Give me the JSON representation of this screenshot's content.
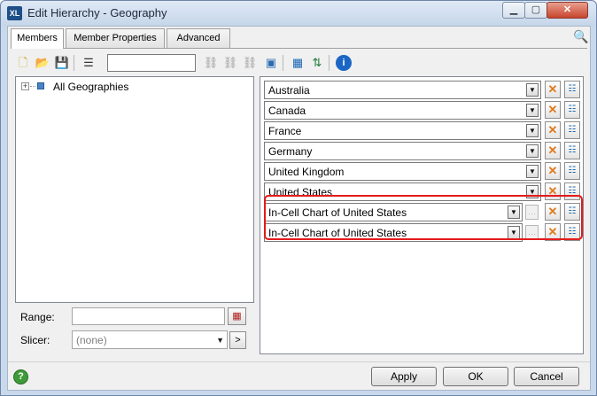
{
  "window": {
    "app_icon": "XL",
    "title": "Edit Hierarchy - Geography",
    "minimize_glyph": "▁",
    "maximize_glyph": "▢",
    "close_glyph": "✕"
  },
  "tabs": [
    {
      "label": "Members",
      "active": true
    },
    {
      "label": "Member Properties",
      "active": false
    },
    {
      "label": "Advanced",
      "active": false
    }
  ],
  "toolbar": {
    "icons": [
      "new-icon",
      "open-icon",
      "save-icon",
      "tree-icon",
      "search-field",
      "link-icon",
      "link-add-icon",
      "link-remove-icon",
      "browse-icon",
      "calendar-icon",
      "sort-icon",
      "info-icon"
    ],
    "search_value": ""
  },
  "tree": {
    "root_label": "All Geographies",
    "expander": "+"
  },
  "range": {
    "label": "Range:",
    "value": ""
  },
  "slicer": {
    "label": "Slicer:",
    "value": "(none)",
    "go_glyph": ">"
  },
  "members": [
    {
      "label": "Australia"
    },
    {
      "label": "Canada"
    },
    {
      "label": "France"
    },
    {
      "label": "Germany"
    },
    {
      "label": "United Kingdom"
    },
    {
      "label": "United States"
    },
    {
      "label": "In-Cell Chart of United States"
    },
    {
      "label": "In-Cell Chart of United States"
    }
  ],
  "buttons": {
    "help": "?",
    "apply": "Apply",
    "ok": "OK",
    "cancel": "Cancel"
  },
  "colors": {
    "highlight": "#e41b1b",
    "delete_icon": "#e07a1d",
    "title_bar": "#c6d6ea"
  }
}
